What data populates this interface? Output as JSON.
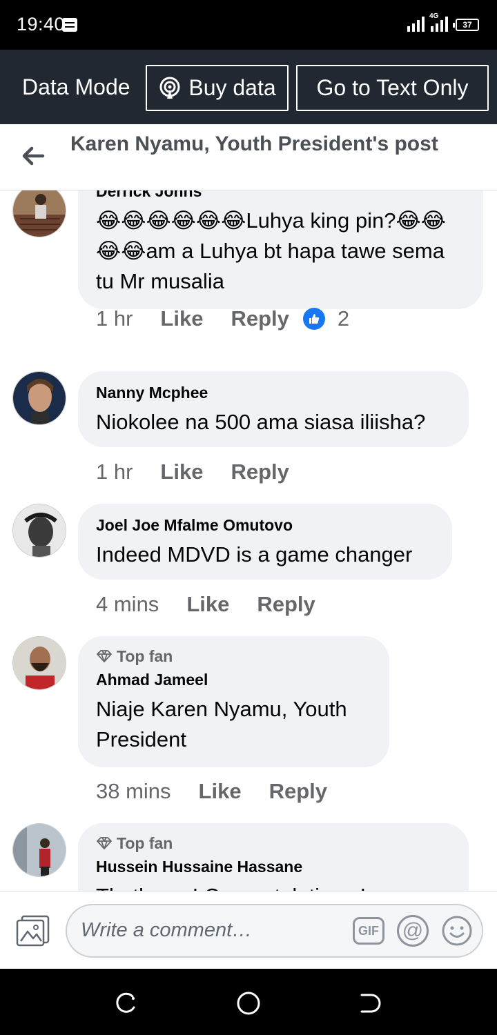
{
  "status_bar": {
    "time": "19:40",
    "network": "4G",
    "battery": "37"
  },
  "data_bar": {
    "label": "Data Mode",
    "buy_data": "Buy data",
    "text_only": "Go to Text Only"
  },
  "header": {
    "title": "Karen Nyamu, Youth President's post"
  },
  "comments": [
    {
      "author": "Derrick Johns",
      "text": "😂😂😂😂😂😂Luhya king pin?😂😂😂😂am a Luhya bt hapa tawe sema tu Mr musalia",
      "time": "1 hr",
      "like": "Like",
      "reply": "Reply",
      "reactions": "2"
    },
    {
      "author": "Nanny Mcphee",
      "text": "Niokolee na 500 ama siasa iliisha?",
      "time": "1 hr",
      "like": "Like",
      "reply": "Reply"
    },
    {
      "author": "Joel Joe Mfalme Omutovo",
      "text": "Indeed MDVD is a game changer",
      "time": "4 mins",
      "like": "Like",
      "reply": "Reply"
    },
    {
      "badge": "Top fan",
      "author": "Ahmad Jameel",
      "text": "Niaje  Karen Nyamu, Youth President",
      "time": "38 mins",
      "like": "Like",
      "reply": "Reply"
    },
    {
      "badge": "Top fan",
      "author": "Hussein Hussaine Hassane",
      "text": "Thatha ... ! Congratulations !"
    }
  ],
  "composer": {
    "placeholder": "Write a comment…",
    "gif": "GIF",
    "at": "@"
  },
  "icons": {
    "back": "arrow-left-icon",
    "photo": "photo-icon",
    "gif": "gif-icon",
    "mention": "at-icon",
    "emoji": "smile-icon",
    "like": "thumbs-up-icon",
    "top_fan": "diamond-icon"
  },
  "colors": {
    "like_blue": "#1877f2",
    "data_bar": "#222831",
    "bubble": "#f0f2f5"
  }
}
